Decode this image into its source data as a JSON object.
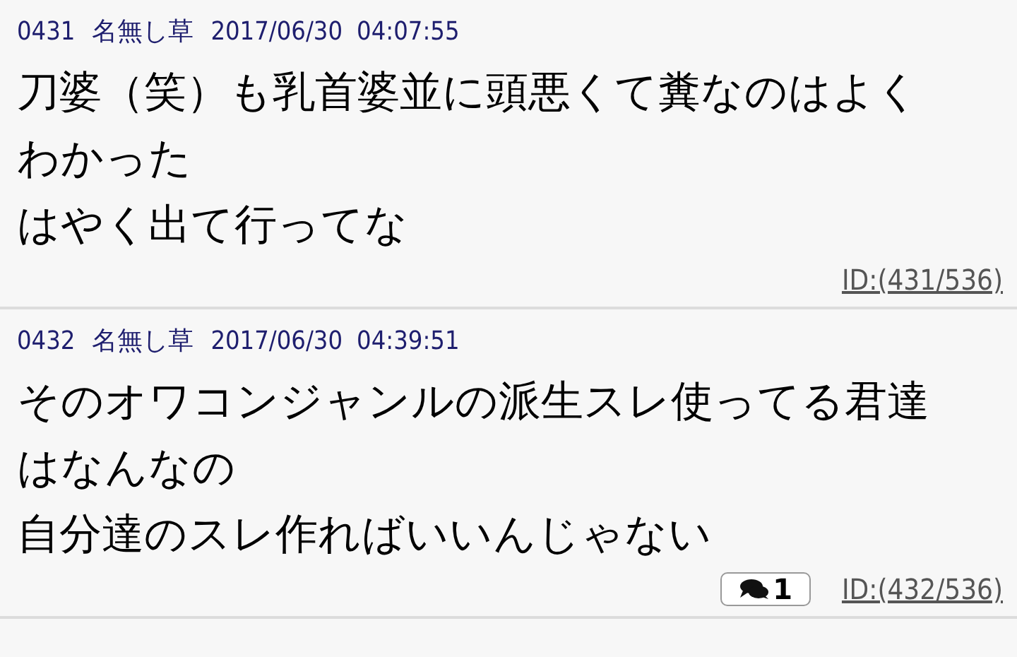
{
  "posts": [
    {
      "number": "0431",
      "name": "名無し草",
      "date": "2017/06/30",
      "time": "04:07:55",
      "body_lines": [
        "刀婆（笑）も乳首婆並に頭悪くて糞なのはよく",
        "わかった",
        "はやく出て行ってな"
      ],
      "id": "ID:(431/536)"
    },
    {
      "number": "0432",
      "name": "名無し草",
      "date": "2017/06/30",
      "time": "04:39:51",
      "body_lines": [
        "そのオワコンジャンルの派生スレ使ってる君達",
        "はなんなの",
        "自分達のスレ作ればいいんじゃない"
      ],
      "replies": "1",
      "id": "ID:(432/536)"
    }
  ]
}
